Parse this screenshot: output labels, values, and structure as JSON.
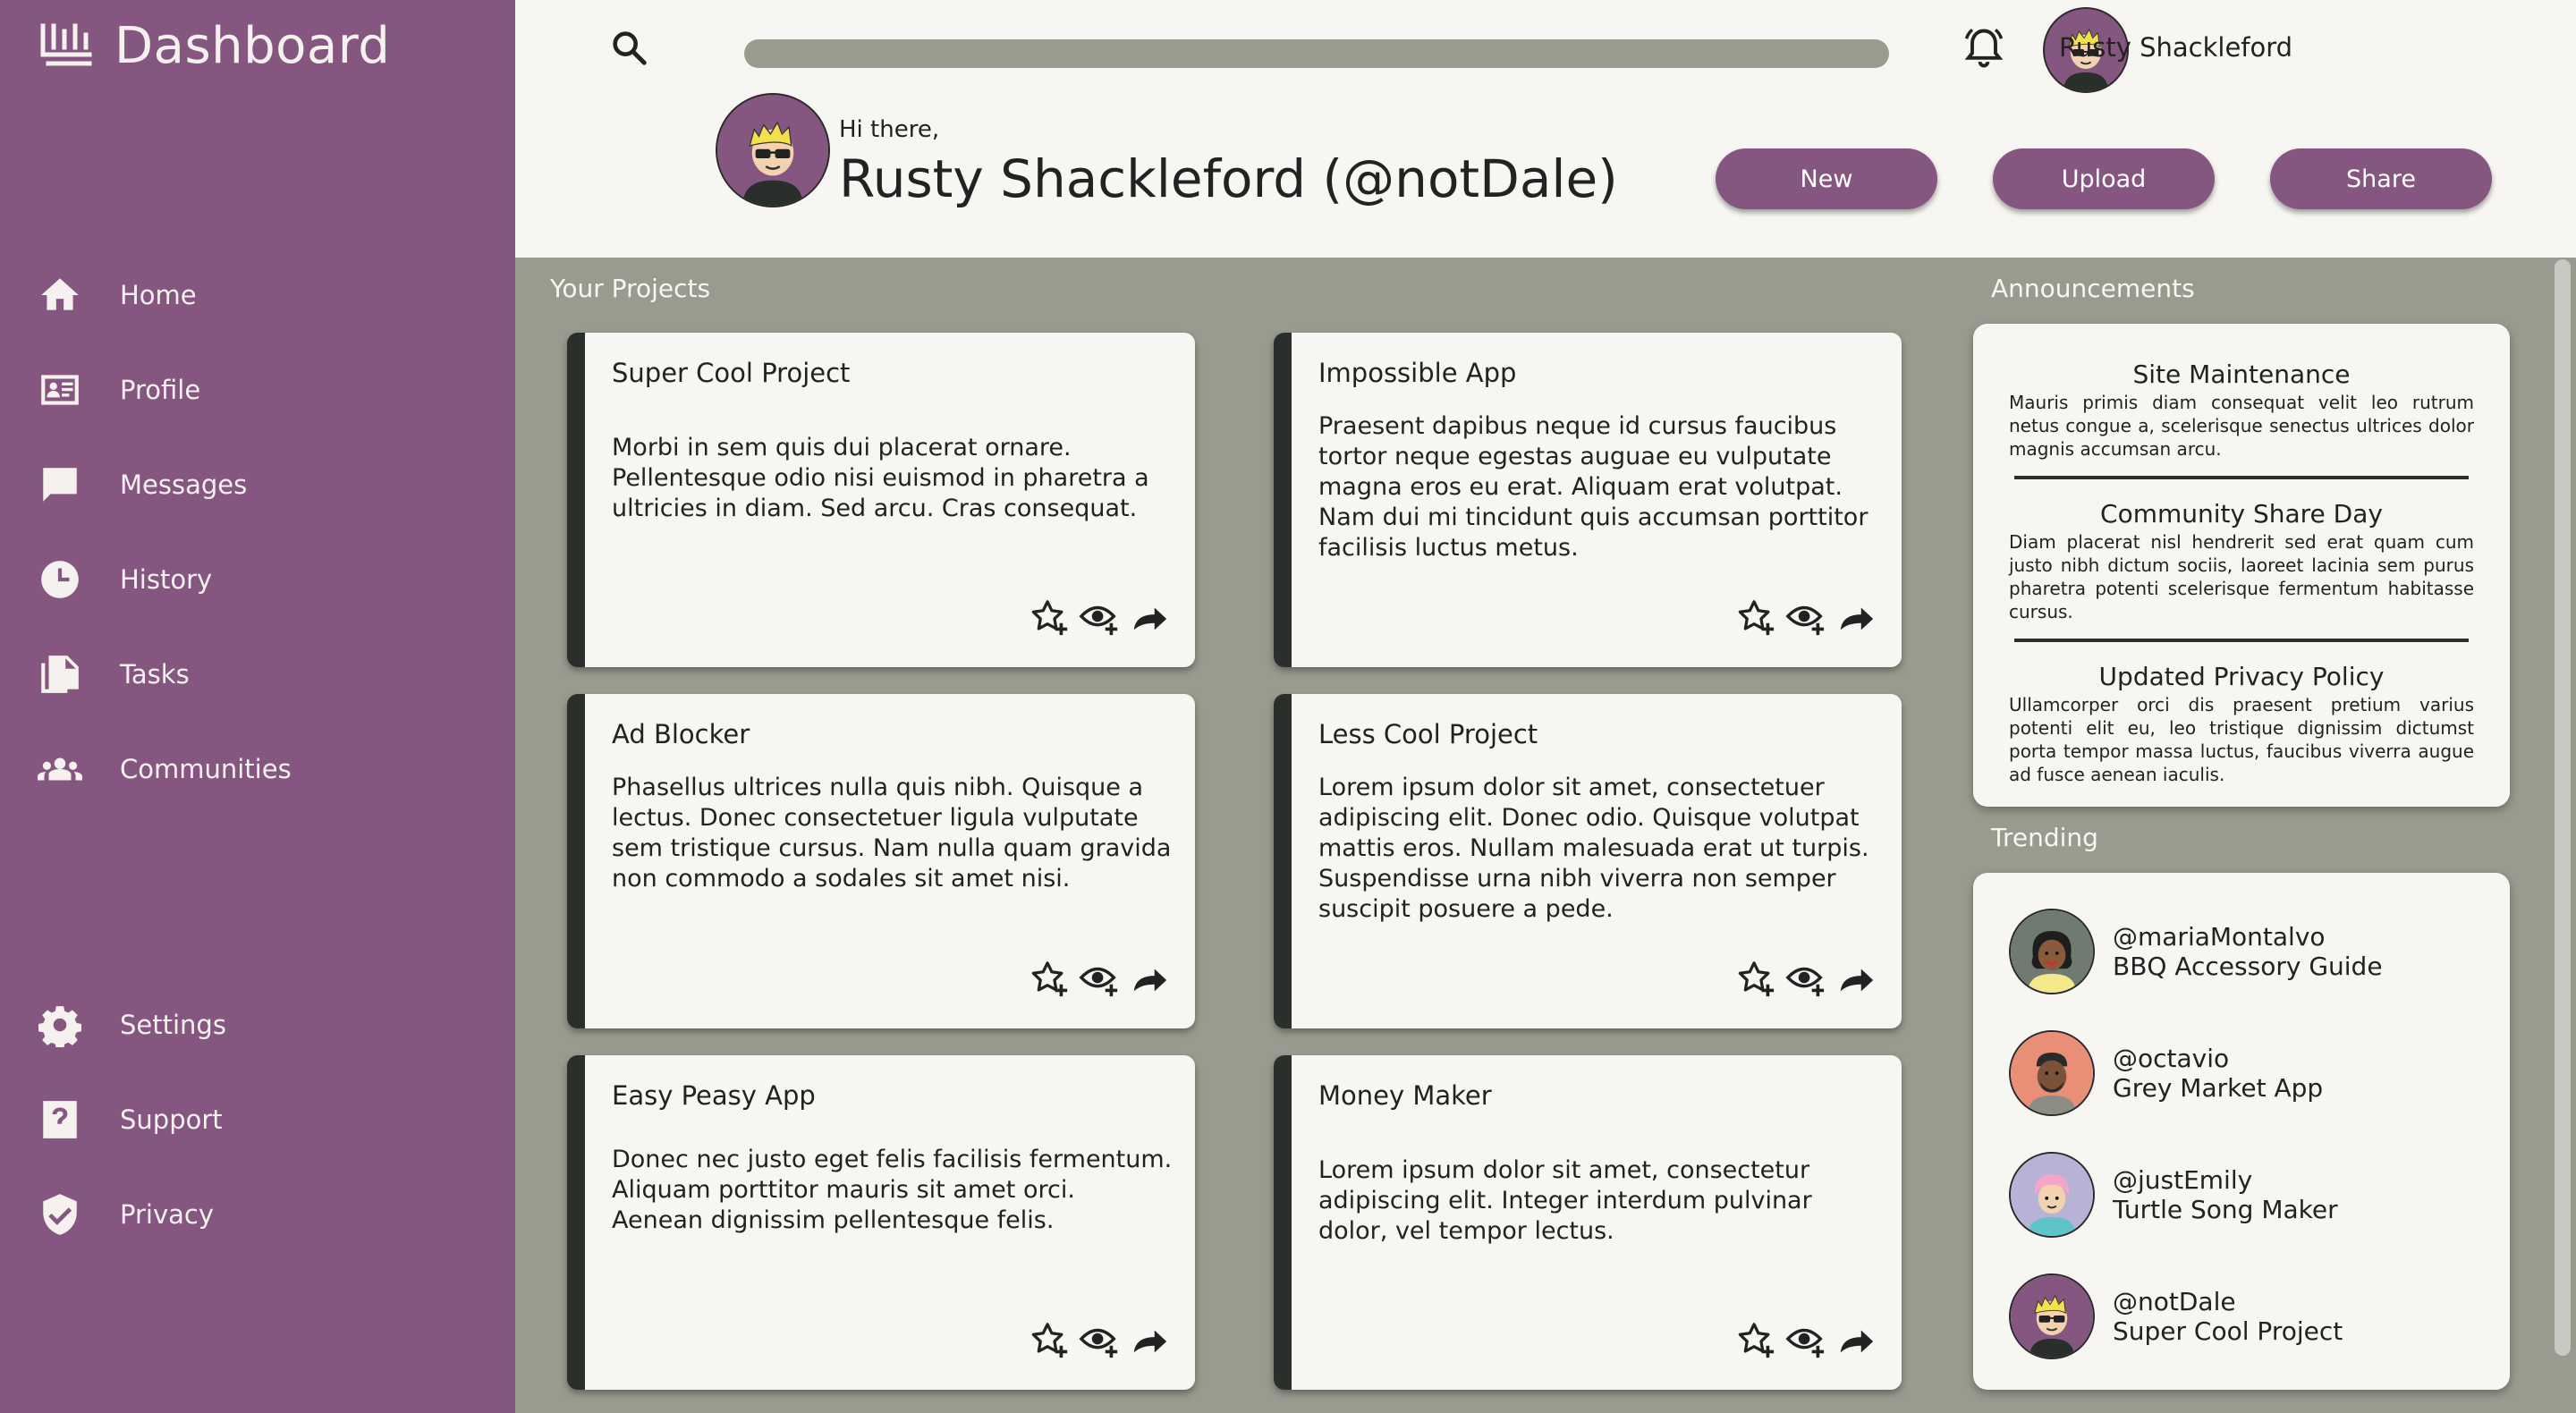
{
  "app": {
    "title": "Dashboard"
  },
  "sidebar": {
    "top_items": [
      {
        "label": "Home",
        "icon": "home-icon"
      },
      {
        "label": "Profile",
        "icon": "profile-card-icon"
      },
      {
        "label": "Messages",
        "icon": "message-icon"
      },
      {
        "label": "History",
        "icon": "clock-icon"
      },
      {
        "label": "Tasks",
        "icon": "documents-icon"
      },
      {
        "label": "Communities",
        "icon": "group-icon"
      }
    ],
    "bottom_items": [
      {
        "label": "Settings",
        "icon": "gear-icon"
      },
      {
        "label": "Support",
        "icon": "help-icon"
      },
      {
        "label": "Privacy",
        "icon": "shield-check-icon"
      }
    ]
  },
  "header": {
    "user_name": "Rusty Shackleford",
    "greeting": "Hi there,",
    "greeting_name": "Rusty Shackleford (@notDale)",
    "search_placeholder": "",
    "buttons": {
      "new": "New",
      "upload": "Upload",
      "share": "Share"
    }
  },
  "projects": {
    "label": "Your Projects",
    "items": [
      {
        "title": "Super Cool Project",
        "body": "Morbi in sem quis dui placerat ornare. Pellentesque odio nisi euismod in pharetra a ultricies in diam. Sed arcu. Cras consequat."
      },
      {
        "title": "Impossible App",
        "body": "Praesent dapibus neque id cursus faucibus tortor neque egestas auguae eu vulputate magna eros eu erat. Aliquam erat volutpat. Nam dui mi tincidunt quis accumsan porttitor facilisis luctus metus."
      },
      {
        "title": "Ad Blocker",
        "body": "Phasellus ultrices nulla quis nibh. Quisque a lectus. Donec consectetuer ligula vulputate sem tristique cursus. Nam nulla quam gravida non commodo a sodales sit amet nisi."
      },
      {
        "title": "Less Cool Project",
        "body": "Lorem ipsum dolor sit amet, consectetuer adipiscing elit. Donec odio. Quisque volutpat mattis eros. Nullam malesuada erat ut turpis. Suspendisse urna nibh viverra non semper suscipit posuere a pede."
      },
      {
        "title": "Easy Peasy App",
        "body": "Donec nec justo eget felis facilisis fermentum. Aliquam porttitor mauris sit amet orci. Aenean dignissim pellentesque felis."
      },
      {
        "title": "Money Maker",
        "body": "Lorem ipsum dolor sit amet, consectetur adipiscing elit. Integer interdum pulvinar dolor, vel tempor lectus."
      }
    ]
  },
  "announcements": {
    "label": "Announcements",
    "items": [
      {
        "title": "Site Maintenance",
        "body": "Mauris primis diam consequat velit leo rutrum netus congue a, scelerisque senectus ultrices dolor magnis accumsan arcu."
      },
      {
        "title": "Community Share Day",
        "body": "Diam placerat nisl hendrerit sed erat quam cum justo nibh dictum sociis, laoreet lacinia sem purus pharetra potenti scelerisque fermentum habitasse cursus."
      },
      {
        "title": "Updated Privacy Policy",
        "body": "Ullamcorper orci dis praesent pretium varius potenti elit eu, leo tristique dignissim dictumst porta tempor massa luctus, faucibus viverra augue ad fusce aenean iaculis."
      }
    ]
  },
  "trending": {
    "label": "Trending",
    "items": [
      {
        "handle": "@mariaMontalvo",
        "project": "BBQ Accessory Guide"
      },
      {
        "handle": "@octavio",
        "project": "Grey Market App"
      },
      {
        "handle": "@justEmily",
        "project": "Turtle Song Maker"
      },
      {
        "handle": "@notDale",
        "project": "Super Cool Project"
      }
    ]
  },
  "colors": {
    "sidebar": "#85567f",
    "background": "#9a9b8f",
    "surface": "#f8f6f3",
    "card_accent": "#2b2f2b"
  }
}
